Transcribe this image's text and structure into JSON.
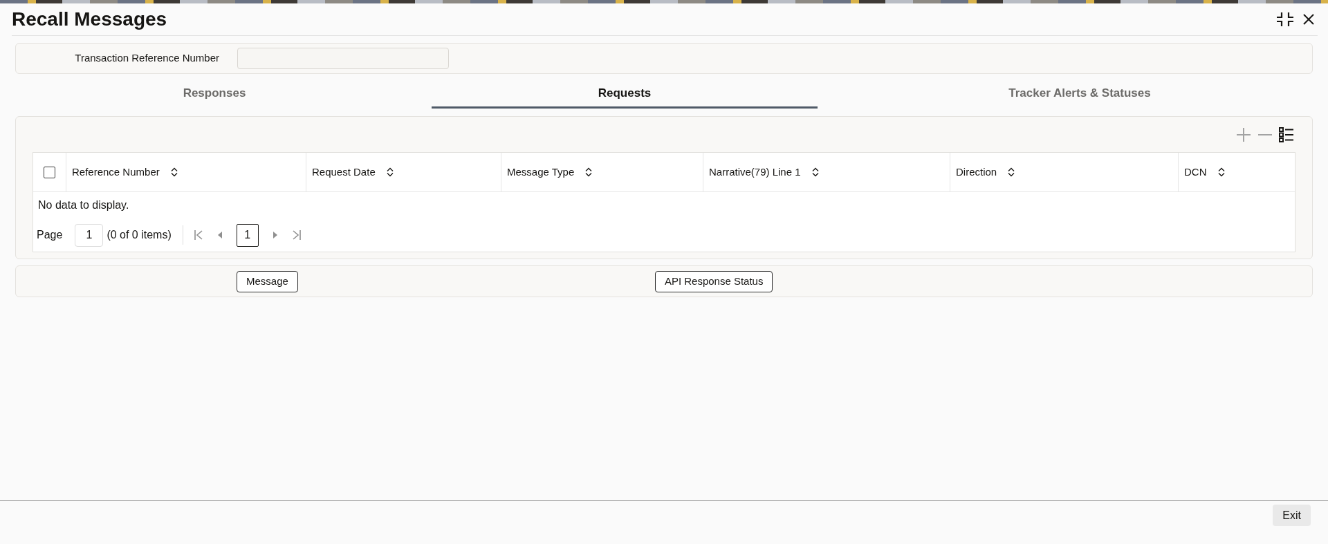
{
  "window": {
    "title": "Recall Messages"
  },
  "filter": {
    "label": "Transaction Reference Number"
  },
  "tabs": [
    {
      "label": "Responses",
      "selected": false
    },
    {
      "label": "Requests",
      "selected": true
    },
    {
      "label": "Tracker Alerts & Statuses",
      "selected": false
    }
  ],
  "table": {
    "toolbar": [
      {
        "kind": "add",
        "disabled": true
      },
      {
        "kind": "remove",
        "disabled": true
      },
      {
        "kind": "columns",
        "disabled": false
      }
    ],
    "select_all": {
      "checked": false
    },
    "columns": [
      "Reference Number",
      "Request Date",
      "Message Type",
      "Narrative(79) Line 1",
      "Direction",
      "DCN"
    ],
    "empty_message": "No data to display.",
    "pagination": {
      "label": "Page",
      "page_field": "1",
      "summary": "(0 of 0 items)",
      "nav": [
        {
          "kind": "first",
          "disabled": true
        },
        {
          "kind": "previous",
          "disabled": true
        },
        {
          "kind": "next",
          "disabled": true
        },
        {
          "kind": "last",
          "disabled": true
        }
      ],
      "pages": [
        {
          "label": "1",
          "selected": true
        }
      ]
    }
  },
  "actions": [
    "Message",
    "API Response Status"
  ],
  "footer": {
    "buttons": [
      "Exit"
    ]
  }
}
